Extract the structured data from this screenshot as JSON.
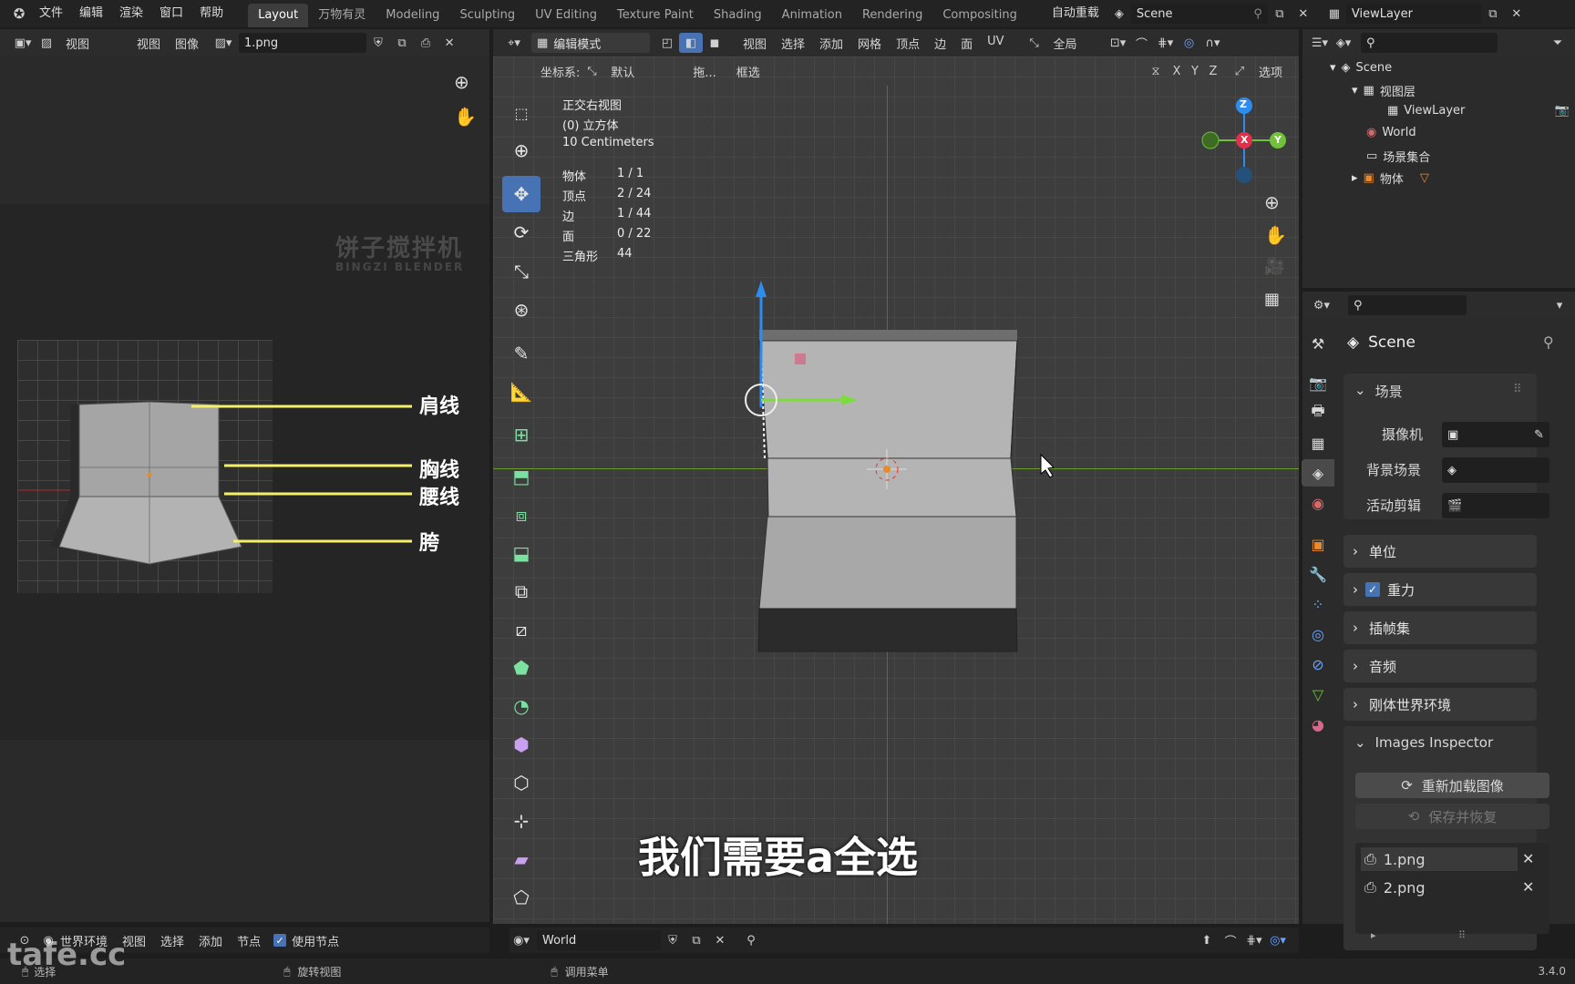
{
  "topbar": {
    "menus": [
      "文件",
      "编辑",
      "渲染",
      "窗口",
      "帮助"
    ],
    "workspaces": [
      "Layout",
      "万物有灵",
      "Modeling",
      "Sculpting",
      "UV Editing",
      "Texture Paint",
      "Shading",
      "Animation",
      "Rendering",
      "Compositing"
    ],
    "active_workspace": "Layout",
    "auto_reload": "自动重载",
    "scene": "Scene",
    "view_layer": "ViewLayer"
  },
  "image_editor": {
    "menus": [
      "视图",
      "图像"
    ],
    "view_label": "视图",
    "image_name": "1.png",
    "watermark": "饼子搅拌机",
    "watermark_en": "BINGZI BLENDER",
    "labels": [
      "肩线",
      "胸线",
      "腰线",
      "胯"
    ]
  },
  "viewport": {
    "mode": "编辑模式",
    "menus": [
      "视图",
      "选择",
      "添加",
      "网格",
      "顶点",
      "边",
      "面",
      "UV"
    ],
    "orientation": "全局",
    "coord_label": "坐标系:",
    "coord_value": "默认",
    "drag_label": "拖...",
    "select_mode": "框选",
    "options": "选项",
    "axes_toggle": [
      "X",
      "Y",
      "Z"
    ],
    "view_name": "正交右视图",
    "object_name": "(0) 立方体",
    "scale": "10 Centimeters",
    "stats": [
      {
        "k": "物体",
        "v": "1 / 1"
      },
      {
        "k": "顶点",
        "v": "2 / 24"
      },
      {
        "k": "边",
        "v": "1 / 44"
      },
      {
        "k": "面",
        "v": "0 / 22"
      },
      {
        "k": "三角形",
        "v": "44"
      }
    ],
    "gizmo": {
      "z": "Z",
      "x": "X",
      "y": "Y"
    },
    "subtitle": "我们需要a全选",
    "colors": {
      "grid_x_axis": "#6a9a2e",
      "grid_z_axis": "#2d6fa8",
      "selected": "#4772b3"
    }
  },
  "outliner": {
    "scene": "Scene",
    "view_layer_group": "视图层",
    "view_layer": "ViewLayer",
    "world": "World",
    "collection": "场景集合",
    "object": "物体"
  },
  "properties": {
    "title": "Scene",
    "panels": {
      "scene": "场景",
      "camera": "摄像机",
      "bg_scene": "背景场景",
      "active_clip": "活动剪辑",
      "units": "单位",
      "gravity": "重力",
      "gravity_checked": true,
      "keying_sets": "插帧集",
      "audio": "音频",
      "rigid_world": "刚体世界环境",
      "images_inspector": "Images Inspector",
      "reload": "重新加载图像",
      "save_restore": "保存并恢复",
      "images": [
        "1.png",
        "2.png"
      ]
    }
  },
  "node_editor": {
    "world_env": "世界环境",
    "menus": [
      "视图",
      "选择",
      "添加",
      "节点"
    ],
    "use_nodes": "使用节点",
    "world_name": "World"
  },
  "statusbar": {
    "select": "选择",
    "rotate": "旋转视图",
    "menu": "调用菜单",
    "version": "3.4.0",
    "watermark": "tafe.cc"
  }
}
